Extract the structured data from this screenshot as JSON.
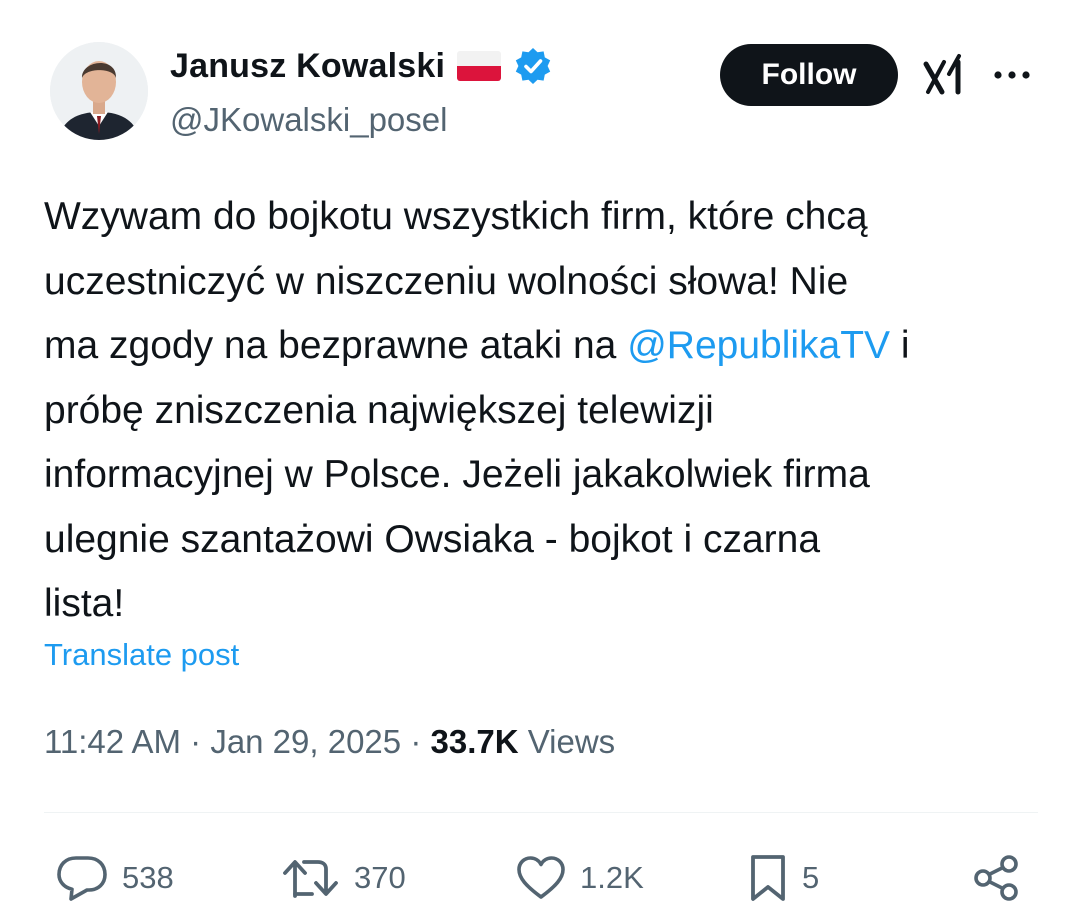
{
  "author": {
    "display_name": "Janusz Kowalski",
    "handle": "@JKowalski_posel",
    "flag_icon": "poland-flag-icon",
    "verified_icon": "verified-badge-icon",
    "verified_color": "#1d9bf0"
  },
  "header": {
    "follow_label": "Follow",
    "grok_icon": "grok-icon",
    "more_icon": "more-options-icon"
  },
  "tweet": {
    "lines": [
      "Wzywam do bojkotu wszystkich firm, które chcą",
      "uczestniczyć w niszczeniu wolności słowa! Nie",
      "ma zgody na bezprawne ataki na ",
      " i",
      "próbę zniszczenia największej telewizji",
      "informacyjnej w Polsce. Jeżeli jakakolwiek firma",
      "ulegnie szantażowi Owsiaka - bojkot i czarna",
      "lista!"
    ],
    "mention": "@RepublikaTV",
    "translate_label": "Translate post"
  },
  "meta": {
    "time": "11:42 AM",
    "separator": " · ",
    "date": "Jan 29, 2025",
    "views_count": "33.7K",
    "views_label": " Views"
  },
  "actions": {
    "replies": "538",
    "reposts": "370",
    "likes": "1.2K",
    "bookmarks": "5"
  },
  "colors": {
    "text": "#0f1419",
    "secondary": "#536471",
    "accent": "#1d9bf0",
    "button_bg": "#0f1419"
  }
}
